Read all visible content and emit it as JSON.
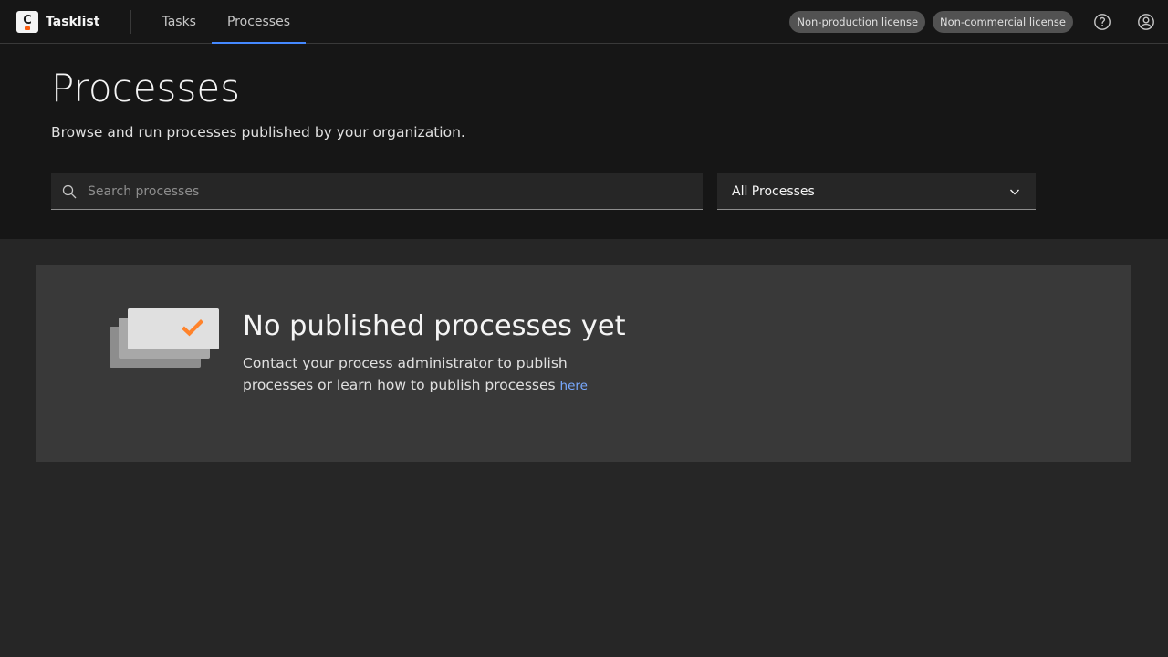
{
  "header": {
    "logo_letter": "C",
    "brand": "Tasklist",
    "nav": [
      {
        "label": "Tasks",
        "active": false
      },
      {
        "label": "Processes",
        "active": true
      }
    ],
    "badges": [
      "Non-production license",
      "Non-commercial license"
    ],
    "icons": [
      "help-icon",
      "user-icon"
    ]
  },
  "page": {
    "title": "Processes",
    "subtitle": "Browse and run processes published by your organization."
  },
  "search": {
    "placeholder": "Search processes",
    "value": ""
  },
  "filter": {
    "selected": "All Processes"
  },
  "empty_state": {
    "title": "No published processes yet",
    "text": "Contact your process administrator to publish processes or learn how to publish processes",
    "link_label": "here"
  },
  "colors": {
    "accent": "#4589ff",
    "check": "#ff832b",
    "link": "#78a9ff"
  }
}
